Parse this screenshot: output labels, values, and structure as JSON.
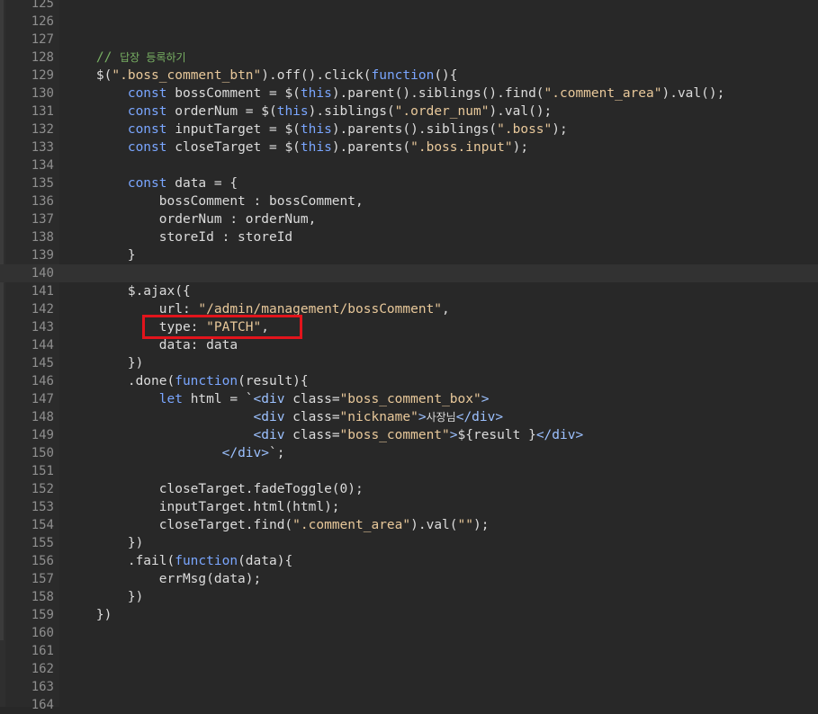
{
  "editor": {
    "colors": {
      "background": "#282828",
      "line_number": "#8f8f8f",
      "keyword": "#7aa6ff",
      "string": "#e8c89a",
      "comment": "#78b063",
      "highlight_box": "#e2141c"
    },
    "current_line": 140,
    "highlight_line": 143,
    "lines": [
      {
        "n": "125",
        "tokens": []
      },
      {
        "n": "126",
        "tokens": []
      },
      {
        "n": "127",
        "tokens": []
      },
      {
        "n": "128",
        "tokens": [
          [
            "    ",
            "plain"
          ],
          [
            "// ",
            "comment"
          ],
          [
            "답장 등록하기",
            "comment ko"
          ]
        ]
      },
      {
        "n": "129",
        "tokens": [
          [
            "    $(",
            "plain"
          ],
          [
            "\".boss_comment_btn\"",
            "str"
          ],
          [
            ").off().click(",
            "plain"
          ],
          [
            "function",
            "kw"
          ],
          [
            "(){",
            "plain"
          ]
        ]
      },
      {
        "n": "130",
        "tokens": [
          [
            "        ",
            "plain"
          ],
          [
            "const",
            "kw"
          ],
          [
            " bossComment = $(",
            "plain"
          ],
          [
            "this",
            "kw"
          ],
          [
            ").parent().siblings().find(",
            "plain"
          ],
          [
            "\".comment_area\"",
            "str"
          ],
          [
            ").val();",
            "plain"
          ]
        ]
      },
      {
        "n": "131",
        "tokens": [
          [
            "        ",
            "plain"
          ],
          [
            "const",
            "kw"
          ],
          [
            " orderNum = $(",
            "plain"
          ],
          [
            "this",
            "kw"
          ],
          [
            ").siblings(",
            "plain"
          ],
          [
            "\".order_num\"",
            "str"
          ],
          [
            ").val();",
            "plain"
          ]
        ]
      },
      {
        "n": "132",
        "tokens": [
          [
            "        ",
            "plain"
          ],
          [
            "const",
            "kw"
          ],
          [
            " inputTarget = $(",
            "plain"
          ],
          [
            "this",
            "kw"
          ],
          [
            ").parents().siblings(",
            "plain"
          ],
          [
            "\".boss\"",
            "str"
          ],
          [
            ");",
            "plain"
          ]
        ]
      },
      {
        "n": "133",
        "tokens": [
          [
            "        ",
            "plain"
          ],
          [
            "const",
            "kw"
          ],
          [
            " closeTarget = $(",
            "plain"
          ],
          [
            "this",
            "kw"
          ],
          [
            ").parents(",
            "plain"
          ],
          [
            "\".boss.input\"",
            "str"
          ],
          [
            ");",
            "plain"
          ]
        ]
      },
      {
        "n": "134",
        "tokens": []
      },
      {
        "n": "135",
        "tokens": [
          [
            "        ",
            "plain"
          ],
          [
            "const",
            "kw"
          ],
          [
            " data = {",
            "plain"
          ]
        ]
      },
      {
        "n": "136",
        "tokens": [
          [
            "            bossComment : bossComment,",
            "plain"
          ]
        ]
      },
      {
        "n": "137",
        "tokens": [
          [
            "            orderNum : orderNum,",
            "plain"
          ]
        ]
      },
      {
        "n": "138",
        "tokens": [
          [
            "            storeId : storeId",
            "plain"
          ]
        ]
      },
      {
        "n": "139",
        "tokens": [
          [
            "        }",
            "plain"
          ]
        ]
      },
      {
        "n": "140",
        "tokens": []
      },
      {
        "n": "141",
        "tokens": [
          [
            "        $.ajax({",
            "plain"
          ]
        ]
      },
      {
        "n": "142",
        "tokens": [
          [
            "            url: ",
            "plain"
          ],
          [
            "\"/admin/management/bossComment\"",
            "str"
          ],
          [
            ",",
            "plain"
          ]
        ]
      },
      {
        "n": "143",
        "tokens": [
          [
            "            type: ",
            "plain"
          ],
          [
            "\"PATCH\"",
            "str"
          ],
          [
            ",",
            "plain"
          ]
        ]
      },
      {
        "n": "144",
        "tokens": [
          [
            "            data: data",
            "plain"
          ]
        ]
      },
      {
        "n": "145",
        "tokens": [
          [
            "        })",
            "plain"
          ]
        ]
      },
      {
        "n": "146",
        "tokens": [
          [
            "        .done(",
            "plain"
          ],
          [
            "function",
            "kw"
          ],
          [
            "(result){",
            "plain"
          ]
        ]
      },
      {
        "n": "147",
        "tokens": [
          [
            "            ",
            "plain"
          ],
          [
            "let",
            "kw"
          ],
          [
            " html = `",
            "plain"
          ],
          [
            "<div",
            "tag"
          ],
          [
            " class=",
            "plain"
          ],
          [
            "\"boss_comment_box\"",
            "str"
          ],
          [
            ">",
            "tag"
          ]
        ]
      },
      {
        "n": "148",
        "tokens": [
          [
            "                        ",
            "plain"
          ],
          [
            "<div",
            "tag"
          ],
          [
            " class=",
            "plain"
          ],
          [
            "\"nickname\"",
            "str"
          ],
          [
            ">",
            "tag"
          ],
          [
            "사장님",
            "plain ko"
          ],
          [
            "</div>",
            "tag"
          ]
        ]
      },
      {
        "n": "149",
        "tokens": [
          [
            "                        ",
            "plain"
          ],
          [
            "<div",
            "tag"
          ],
          [
            " class=",
            "plain"
          ],
          [
            "\"boss_comment\"",
            "str"
          ],
          [
            ">",
            "tag"
          ],
          [
            "${result }",
            "plain"
          ],
          [
            "</div>",
            "tag"
          ]
        ]
      },
      {
        "n": "150",
        "tokens": [
          [
            "                    ",
            "plain"
          ],
          [
            "</div>",
            "tag"
          ],
          [
            "`;",
            "plain"
          ]
        ]
      },
      {
        "n": "151",
        "tokens": []
      },
      {
        "n": "152",
        "tokens": [
          [
            "            closeTarget.fadeToggle(0);",
            "plain"
          ]
        ]
      },
      {
        "n": "153",
        "tokens": [
          [
            "            inputTarget.html(html);",
            "plain"
          ]
        ]
      },
      {
        "n": "154",
        "tokens": [
          [
            "            closeTarget.find(",
            "plain"
          ],
          [
            "\".comment_area\"",
            "str"
          ],
          [
            ").val(",
            "plain"
          ],
          [
            "\"\"",
            "str"
          ],
          [
            ");",
            "plain"
          ]
        ]
      },
      {
        "n": "155",
        "tokens": [
          [
            "        })",
            "plain"
          ]
        ]
      },
      {
        "n": "156",
        "tokens": [
          [
            "        .fail(",
            "plain"
          ],
          [
            "function",
            "kw"
          ],
          [
            "(data){",
            "plain"
          ]
        ]
      },
      {
        "n": "157",
        "tokens": [
          [
            "            errMsg(data);",
            "plain"
          ]
        ]
      },
      {
        "n": "158",
        "tokens": [
          [
            "        })",
            "plain"
          ]
        ]
      },
      {
        "n": "159",
        "tokens": [
          [
            "    })",
            "plain"
          ]
        ]
      },
      {
        "n": "160",
        "tokens": []
      },
      {
        "n": "161",
        "tokens": []
      },
      {
        "n": "162",
        "tokens": []
      },
      {
        "n": "163",
        "tokens": []
      },
      {
        "n": "164",
        "tokens": []
      }
    ]
  }
}
